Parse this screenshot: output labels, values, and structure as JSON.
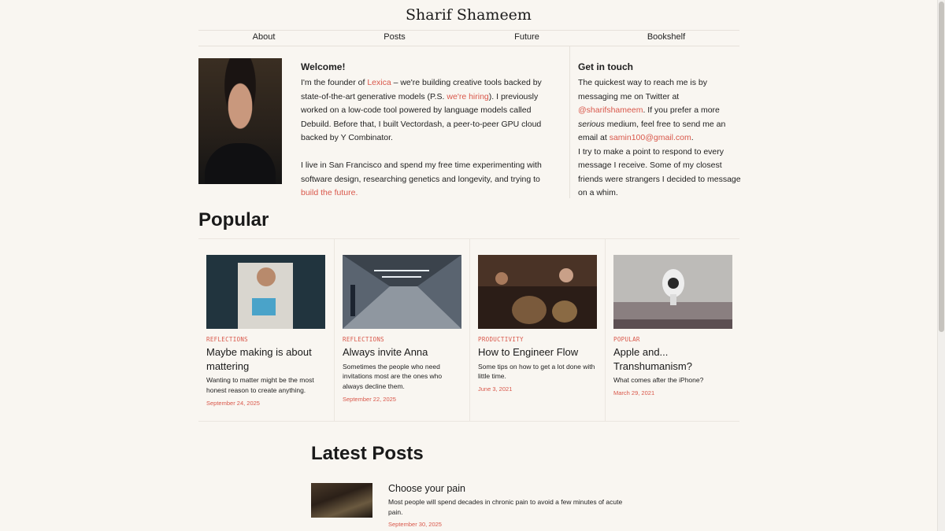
{
  "site": {
    "title": "Sharif Shameem"
  },
  "nav": {
    "items": [
      "About",
      "Posts",
      "Future",
      "Bookshelf"
    ]
  },
  "welcome": {
    "heading": "Welcome!",
    "p1_a": "I'm the founder of ",
    "p1_link1": "Lexica",
    "p1_b": " – we're building creative tools backed by state-of-the-art generative models (P.S. ",
    "p1_link2": "we're hiring",
    "p1_c": "). I previously worked on a low-code tool powered by language models called Debuild. Before that, I built Vectordash, a peer-to-peer GPU cloud backed by Y Combinator.",
    "p2_a": "I live in San Francisco and spend my free time experimenting with software design, researching genetics and longevity, and trying to ",
    "p2_link": "build the future."
  },
  "contact": {
    "heading": "Get in touch",
    "p_a": "The quickest way to reach me is by messaging me on Twitter at ",
    "twitter": "@sharifshameem",
    "p_b": ". If you prefer a more ",
    "p_em": "serious",
    "p_c": " medium, feel free to send me an email at ",
    "email": "samin100@gmail.com",
    "p_d": ".",
    "p2": "I try to make a point to respond to every message I receive. Some of my closest friends were strangers I decided to message on a whim."
  },
  "popular": {
    "title": "Popular",
    "cards": [
      {
        "category": "REFLECTIONS",
        "title": "Maybe making is about mattering",
        "desc": "Wanting to matter might be the most honest reason to create anything.",
        "date": "September 24, 2025"
      },
      {
        "category": "REFLECTIONS",
        "title": "Always invite Anna",
        "desc": "Sometimes the people who need invitations most are the ones who always decline them.",
        "date": "September 22, 2025"
      },
      {
        "category": "PRODUCTIVITY",
        "title": "How to Engineer Flow",
        "desc": "Some tips on how to get a lot done with little time.",
        "date": "June 3, 2021"
      },
      {
        "category": "POPULAR",
        "title": "Apple and... Transhumanism?",
        "desc": "What comes after the iPhone?",
        "date": "March 29, 2021"
      }
    ]
  },
  "latest": {
    "title": "Latest Posts",
    "items": [
      {
        "title": "Choose your pain",
        "desc": "Most people will spend decades in chronic pain to avoid a few minutes of acute pain.",
        "date": "September 30, 2025"
      }
    ]
  },
  "colors": {
    "accent": "#d9574a",
    "background": "#f9f6f1",
    "text": "#1f1f1f"
  }
}
